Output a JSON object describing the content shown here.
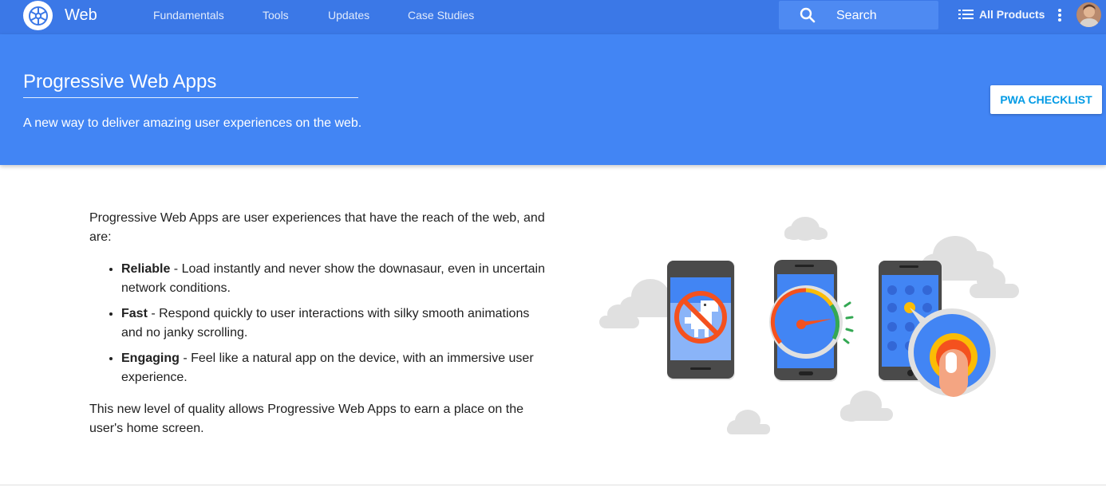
{
  "header": {
    "brand": "Web",
    "nav": [
      "Fundamentals",
      "Tools",
      "Updates",
      "Case Studies"
    ],
    "search_label": "Search",
    "all_products": "All Products"
  },
  "hero": {
    "title": "Progressive Web Apps",
    "subtitle": "A new way to deliver amazing user experiences on the web.",
    "checklist_button": "PWA CHECKLIST"
  },
  "main": {
    "intro": "Progressive Web Apps are user experiences that have the reach of the web, and are:",
    "features": [
      {
        "title": "Reliable",
        "text": " - Load instantly and never show the downasaur, even in uncertain network conditions."
      },
      {
        "title": "Fast",
        "text": " - Respond quickly to user interactions with silky smooth animations and no janky scrolling."
      },
      {
        "title": "Engaging",
        "text": " - Feel like a natural app on the device, with an immersive user experience."
      }
    ],
    "outro": "This new level of quality allows Progressive Web Apps to earn a place on the user's home screen."
  },
  "colors": {
    "topbar": "#3b78e7",
    "hero": "#4285f4",
    "accent": "#039be5"
  },
  "icons": {
    "logo": "web-logo-icon",
    "search": "search-icon",
    "all_products": "list-icon",
    "menu": "more-vert-icon"
  }
}
